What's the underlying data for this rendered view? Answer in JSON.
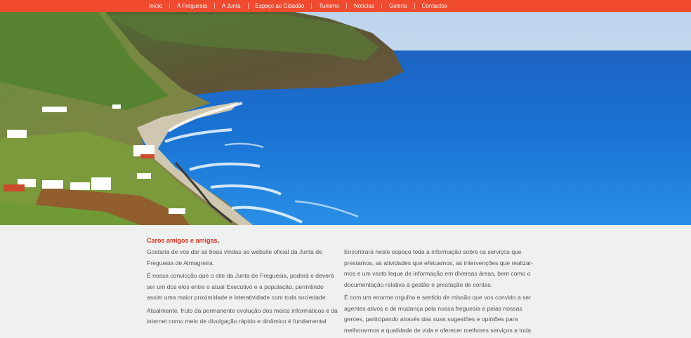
{
  "nav": {
    "items": [
      "Início",
      "A Freguesia",
      "A Junta",
      "Espaço ao Cidadão",
      "Turismo",
      "Notícias",
      "Galeria",
      "Contactos"
    ]
  },
  "hero": {
    "icon": "landscape-photo"
  },
  "welcome": {
    "heading": "Caros amigos e amigas,",
    "left_paragraphs": [
      "Gostaria de vos dar as boas vindas ao website oficial da Junta de Freguesia de Almagreira.",
      "É nossa convicção que o site da Junta de Freguesia, poderá e deverá ser um dos elos entre o atual Executivo e a população, permitindo assim uma maior proximidade e interatividade com toda sociedade.",
      "Atualmente, fruto da permanente evolução dos meios informáticos e da internet como meio de divulgação rápido e dinâmico é fundamental"
    ],
    "right_paragraphs": [
      "Encontrará neste espaço toda a informação sobre os serviços que prestamos, as atividades que efetuamos, as intervenções que realizar-mos e um vasto leque de informação em diversas áreas, bem como o documentação relativa à gestão e prestação de contas.",
      "É com um enorme orgulho e sentido de missão que vos convido a ser agentes ativos e de mudança pela nossa freguesia e pelas nossas gentes, participando através das suas sugestões e opiniões para melhorarmos a qualidade de vida e oferecer melhores serviços a toda"
    ]
  },
  "colors": {
    "nav_bg": "#f04a2f",
    "heading": "#e0321f",
    "page_bg": "#eff1f0"
  }
}
